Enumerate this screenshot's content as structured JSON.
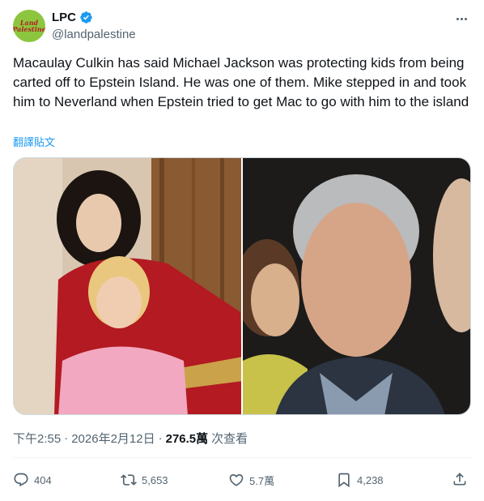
{
  "author": {
    "display_name": "LPC",
    "handle": "@landpalestine",
    "avatar_text_line1": "Land",
    "avatar_text_line2": "Palestine",
    "verified": true
  },
  "tweet": {
    "text": "Macaulay Culkin has said Michael Jackson was protecting kids from being carted off to Epstein Island. He was one of them. Mike stepped in and took him to Neverland when Epstein tried to get Mac to go with him to the island",
    "translate_label": "翻譯貼文"
  },
  "meta": {
    "time": "下午2:55",
    "sep1": "·",
    "date": "2026年2月12日",
    "sep2": "·",
    "views": "276.5萬",
    "views_label": "次查看"
  },
  "actions": {
    "replies": "404",
    "retweets": "5,653",
    "likes": "5.7萬",
    "bookmarks": "4,238"
  },
  "colors": {
    "accent": "#1d9bf0",
    "text": "#0f1419",
    "secondary": "#536471"
  }
}
